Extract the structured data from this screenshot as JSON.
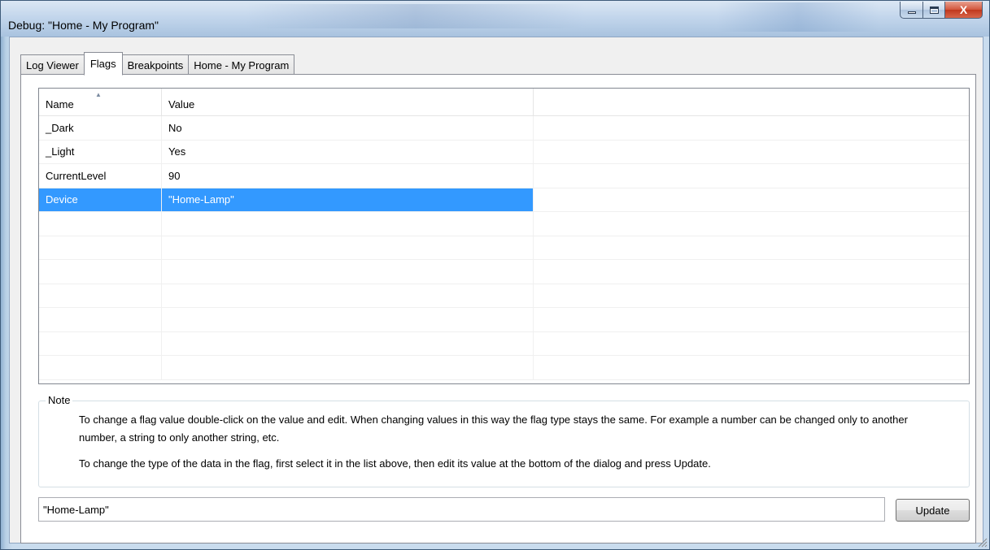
{
  "window": {
    "title": "Debug: \"Home - My Program\"",
    "close_label": "X"
  },
  "tabs": [
    {
      "label": "Log Viewer",
      "active": false
    },
    {
      "label": "Flags",
      "active": true
    },
    {
      "label": "Breakpoints",
      "active": false
    },
    {
      "label": "Home - My Program",
      "active": false
    }
  ],
  "flags_list": {
    "columns": [
      "Name",
      "Value"
    ],
    "sorted_column": "Name",
    "sort_icon": "sort-ascending-icon",
    "selection_color": "#3399ff",
    "rows": [
      {
        "name": "_Dark",
        "value": "No",
        "selected": false
      },
      {
        "name": "_Light",
        "value": "Yes",
        "selected": false
      },
      {
        "name": "CurrentLevel",
        "value": "90",
        "selected": false
      },
      {
        "name": "Device",
        "value": "\"Home-Lamp\"",
        "selected": true
      }
    ]
  },
  "note": {
    "legend": "Note",
    "paragraph1": "To change a flag value double-click on the value and edit.  When changing values in this way the flag type stays the same. For example a number can be changed only to another number, a string to only another string, etc.",
    "paragraph2": "To change the type of the data in the flag, first select it in the list above, then edit its value at the bottom of the dialog and press Update."
  },
  "editor": {
    "value": "\"Home-Lamp\"",
    "update_label": "Update"
  }
}
